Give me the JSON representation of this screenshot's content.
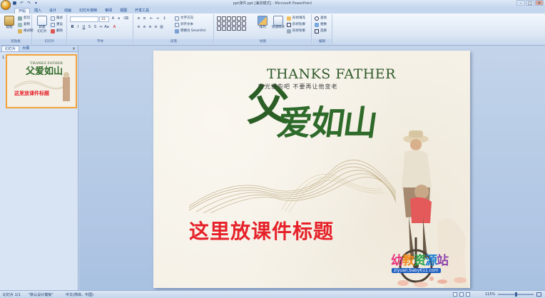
{
  "window": {
    "title": "ppt课件.ppt [兼容模式] - Microsoft PowerPoint",
    "controls": [
      "–",
      "□",
      "×"
    ]
  },
  "qat": {
    "icons": [
      "save-icon",
      "undo-icon",
      "redo-icon",
      "customize-icon"
    ]
  },
  "tabs": [
    "开始",
    "插入",
    "设计",
    "动画",
    "幻灯片放映",
    "审阅",
    "视图",
    "开发工具"
  ],
  "ribbon": {
    "clipboard": {
      "label": "剪贴板",
      "paste": "粘贴",
      "cut": "剪切",
      "copy": "复制",
      "format_painter": "格式刷"
    },
    "slides": {
      "label": "幻灯片",
      "new_slide": "新建\n幻灯片",
      "layout": "版式",
      "reset": "重设",
      "delete": "删除"
    },
    "font": {
      "label": "字体",
      "font_name": "",
      "font_size": "15"
    },
    "paragraph": {
      "label": "段落",
      "text_direction": "文字方向",
      "align_text": "对齐文本",
      "smartart": "转换为 SmartArt"
    },
    "drawing": {
      "label": "绘图",
      "arrange": "排列",
      "quick_styles": "快速样式",
      "fill": "形状填充",
      "outline": "形状轮廓",
      "effects": "形状效果"
    },
    "editing": {
      "label": "编辑",
      "find": "查找",
      "replace": "替换",
      "select": "选择"
    }
  },
  "left_panel": {
    "tabs": [
      "幻灯片",
      "大纲"
    ],
    "close": "×",
    "slide_number": "1",
    "thumb_title": "这里放课件标题"
  },
  "slide": {
    "thanks": "THANKS FATHER",
    "subtitle": "时光慢些吧  不要再让他变老",
    "calligraphy_big": "父",
    "calligraphy": "爱如山",
    "title": "这里放课件标题",
    "logo": [
      "幼",
      "教",
      "资",
      "源",
      "站"
    ],
    "logo_url": "ziyuan.baby611.com"
  },
  "status": {
    "slide_info": "幻灯片 1/1",
    "theme": "\"默认设计模板\"",
    "language": "中文(简体，中国)",
    "zoom": "115%"
  }
}
